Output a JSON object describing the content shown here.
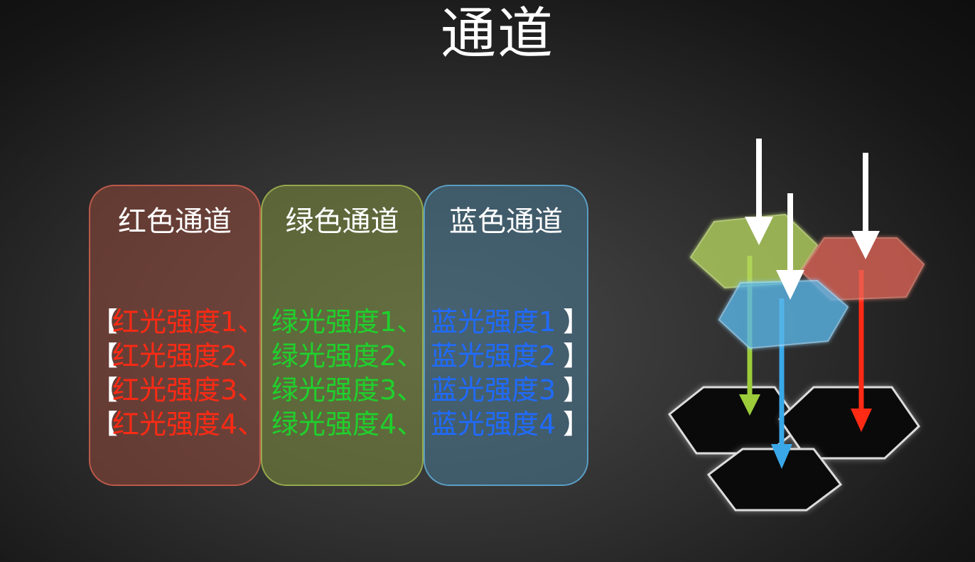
{
  "title": "通道",
  "channels": [
    {
      "name": "红色通道",
      "color": "#ff2a14"
    },
    {
      "name": "绿色通道",
      "color": "#1fd12c"
    },
    {
      "name": "蓝色通道",
      "color": "#1f6bff"
    }
  ],
  "rows": [
    {
      "open": "【",
      "red": "红光强度1、",
      "green": "绿光强度1、",
      "blue": "蓝光强度1",
      "close": "】"
    },
    {
      "open": "【",
      "red": "红光强度2、",
      "green": "绿光强度2、",
      "blue": "蓝光强度2",
      "close": "】"
    },
    {
      "open": "【",
      "red": "红光强度3、",
      "green": "绿光强度3、",
      "blue": "蓝光强度3",
      "close": "】"
    },
    {
      "open": "【",
      "red": "红光强度4、",
      "green": "绿光强度4、",
      "blue": "蓝光强度4",
      "close": "】"
    }
  ],
  "diagram": {
    "filters": [
      {
        "name": "green-filter",
        "color": "#b5d65e"
      },
      {
        "name": "red-filter",
        "color": "#e8685a"
      },
      {
        "name": "blue-filter",
        "color": "#5ab6e8"
      }
    ],
    "light_colors": {
      "white": "#ffffff",
      "green": "#9ccc3a",
      "blue": "#3aa8e8",
      "red": "#ff2a14"
    }
  }
}
